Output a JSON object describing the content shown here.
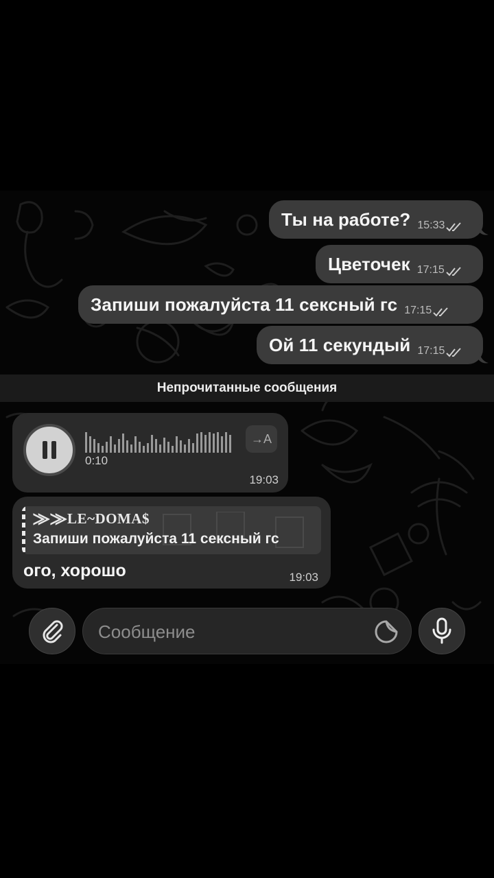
{
  "messages_out": [
    {
      "text": "Ты на работе?",
      "time": "15:33"
    },
    {
      "text": "Цветочек",
      "time": "17:15"
    },
    {
      "text": "Запиши пожалуйста 11 сексный гс",
      "time": "17:15"
    },
    {
      "text": "Ой 11 секундый",
      "time": "17:15"
    }
  ],
  "unread_divider": "Непрочитанные сообщения",
  "voice_message": {
    "duration": "0:10",
    "time": "19:03",
    "transcribe_label": "→A"
  },
  "reply_message": {
    "quote_author": "⨠⨠LE~DOMA$",
    "quote_text": "Запиши пожалуйста 11 сексный гс",
    "text": "ого, хорошо",
    "time": "19:03"
  },
  "input": {
    "placeholder": "Сообщение",
    "value": ""
  },
  "icons": {
    "attach": "paperclip-icon",
    "sticker": "sticker-icon",
    "mic": "microphone-icon",
    "pause": "pause-icon",
    "read": "double-check-icon"
  },
  "colors": {
    "background": "#000000",
    "bubble_out": "#3b3b3b",
    "bubble_in": "#2a2a2a"
  }
}
